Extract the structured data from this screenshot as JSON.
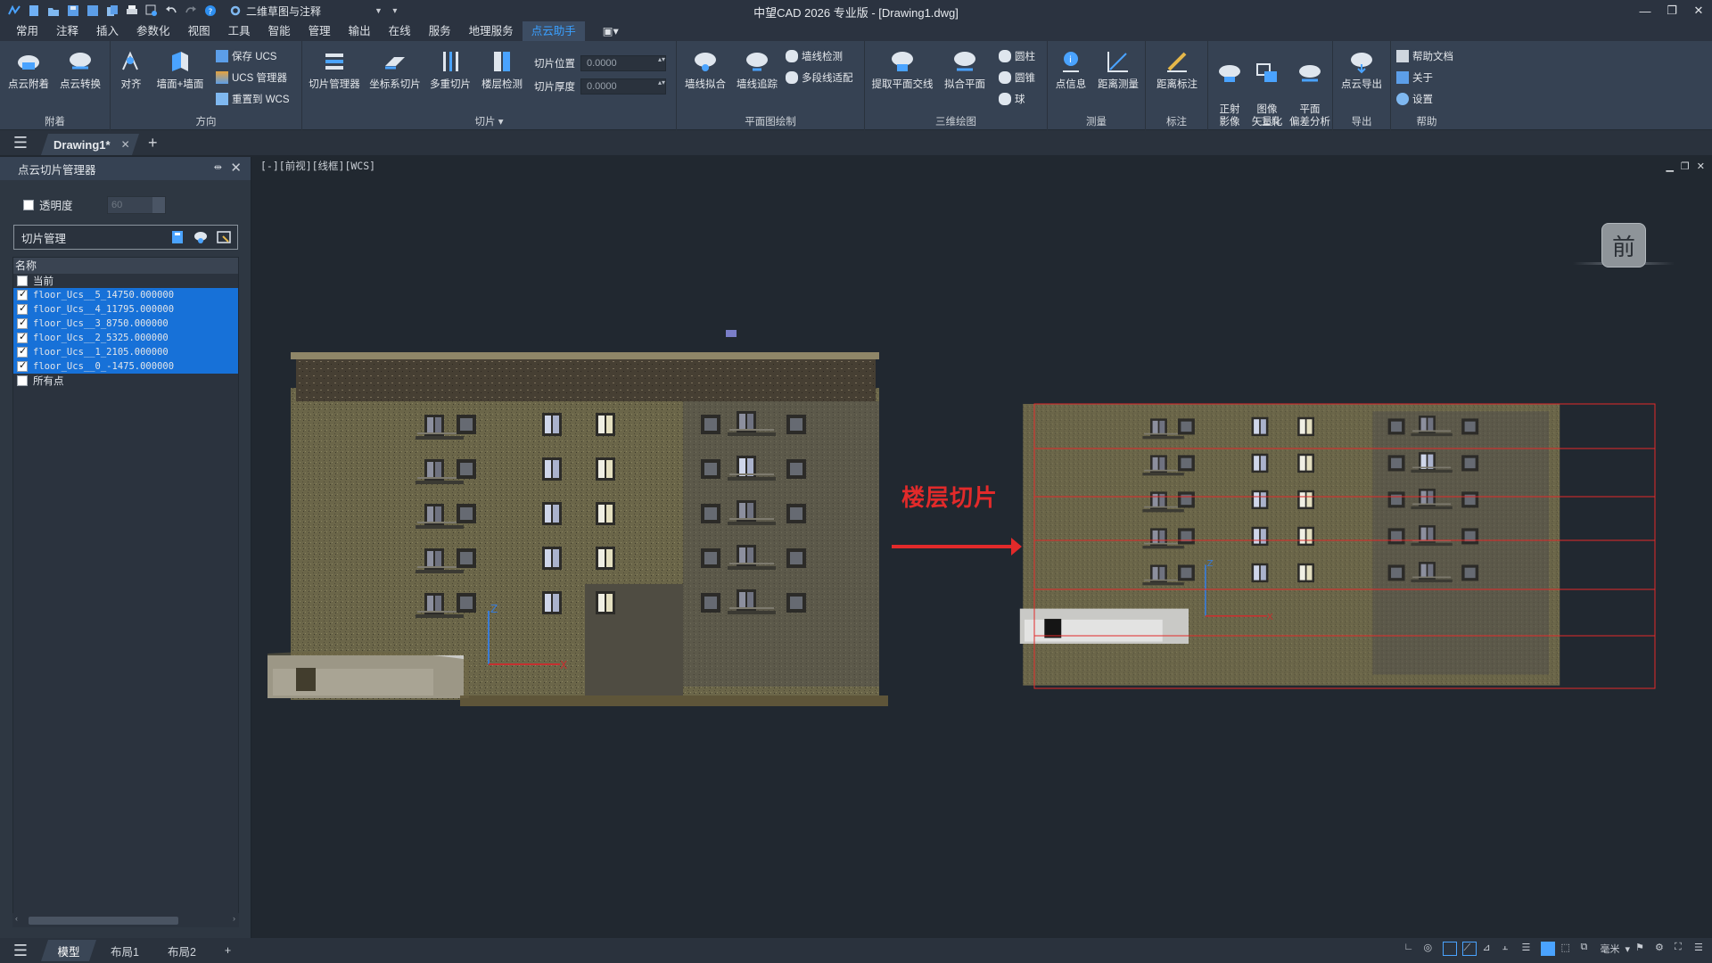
{
  "app": {
    "title": "中望CAD 2026 专业版 - [Drawing1.dwg]",
    "workspace": "二维草图与注释"
  },
  "menu": [
    "常用",
    "注释",
    "插入",
    "参数化",
    "视图",
    "工具",
    "智能",
    "管理",
    "输出",
    "在线",
    "服务",
    "地理服务",
    "点云助手"
  ],
  "active_menu": "点云助手",
  "ribbon": {
    "groups": [
      {
        "label": "附着",
        "buttons": [
          "点云附着",
          "点云转换"
        ]
      },
      {
        "label": "方向",
        "buttons": [
          "对齐",
          "墙面+墙面"
        ],
        "small": [
          "保存 UCS",
          "UCS 管理器",
          "重置到 WCS"
        ]
      },
      {
        "label": "切片",
        "buttons": [
          "切片管理器",
          "坐标系切片",
          "多重切片",
          "楼层检测"
        ],
        "fields": [
          {
            "label": "切片位置",
            "value": "0.0000"
          },
          {
            "label": "切片厚度",
            "value": "0.0000"
          }
        ]
      },
      {
        "label": "平面图绘制",
        "buttons": [
          "墙线拟合",
          "墙线追踪"
        ],
        "small": [
          "墙线检测",
          "多段线适配"
        ]
      },
      {
        "label": "三维绘图",
        "buttons": [
          "提取平面交线",
          "拟合平面"
        ],
        "small": [
          "圆柱",
          "圆锥",
          "球"
        ]
      },
      {
        "label": "测量",
        "buttons": [
          "点信息",
          "距离测量"
        ]
      },
      {
        "label": "标注",
        "buttons": [
          "距离标注"
        ]
      },
      {
        "label": "工具",
        "buttons": [
          "正射\n影像",
          "图像\n矢量化",
          "平面\n偏差分析"
        ]
      },
      {
        "label": "导出",
        "buttons": [
          "点云导出"
        ]
      },
      {
        "label": "帮助",
        "small": [
          "帮助文档",
          "关于",
          "设置"
        ]
      }
    ]
  },
  "doc_tab": {
    "name": "Drawing1*"
  },
  "panel": {
    "title": "点云切片管理器",
    "transparency_label": "透明度",
    "transparency_value": "60",
    "slice_mgmt": "切片管理",
    "list_header": "名称",
    "rows": [
      {
        "label": "当前",
        "checked": false,
        "selected": false
      },
      {
        "label": "floor_Ucs__5_14750.000000",
        "checked": true,
        "selected": true
      },
      {
        "label": "floor_Ucs__4_11795.000000",
        "checked": true,
        "selected": true
      },
      {
        "label": "floor_Ucs__3_8750.000000",
        "checked": true,
        "selected": true
      },
      {
        "label": "floor_Ucs__2_5325.000000",
        "checked": true,
        "selected": true
      },
      {
        "label": "floor_Ucs__1_2105.000000",
        "checked": true,
        "selected": true
      },
      {
        "label": "floor_Ucs__0_-1475.000000",
        "checked": true,
        "selected": true
      },
      {
        "label": "所有点",
        "checked": false,
        "selected": false
      }
    ]
  },
  "viewport": {
    "label": "[-][前视][线框][WCS]",
    "viewcube": "前",
    "annotation": "楼层切片",
    "annotation_color": "#e22a2a"
  },
  "layout_tabs": [
    "模型",
    "布局1",
    "布局2"
  ],
  "status": {
    "units": "毫米"
  }
}
